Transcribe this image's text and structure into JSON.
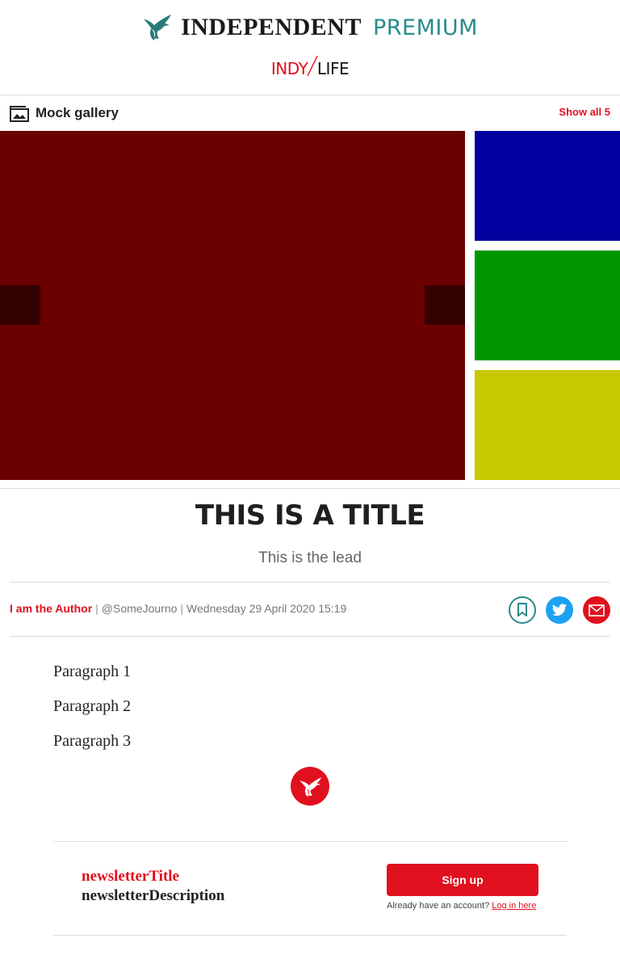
{
  "header": {
    "brand_name": "INDEPENDENT",
    "brand_tier": "PREMIUM",
    "section_a": "INDY",
    "section_slash": "/",
    "section_b": "LIFE"
  },
  "gallery": {
    "title": "Mock gallery",
    "show_all_label": "Show all 5",
    "main_color": "#6b0000",
    "thumbnails": [
      {
        "color": "#00009e"
      },
      {
        "color": "#009600"
      },
      {
        "color": "#c8c800"
      }
    ]
  },
  "article": {
    "title": "THIS IS A TITLE",
    "lead": "This is the lead",
    "author": "I am the Author",
    "twitter_handle": "@SomeJourno",
    "date": "Wednesday 29 April 2020 15:19",
    "paragraphs": [
      "Paragraph 1",
      "Paragraph 2",
      "Paragraph 3"
    ]
  },
  "share": {
    "icons": [
      "bookmark-icon",
      "twitter-icon",
      "email-icon"
    ]
  },
  "newsletter": {
    "title": "newsletterTitle",
    "description": "newsletterDescription",
    "signup_label": "Sign up",
    "login_prompt": "Already have an account?",
    "login_link": "Log in here"
  },
  "colors": {
    "brand_red": "#e0101e",
    "premium_teal": "#2a8a8a"
  }
}
